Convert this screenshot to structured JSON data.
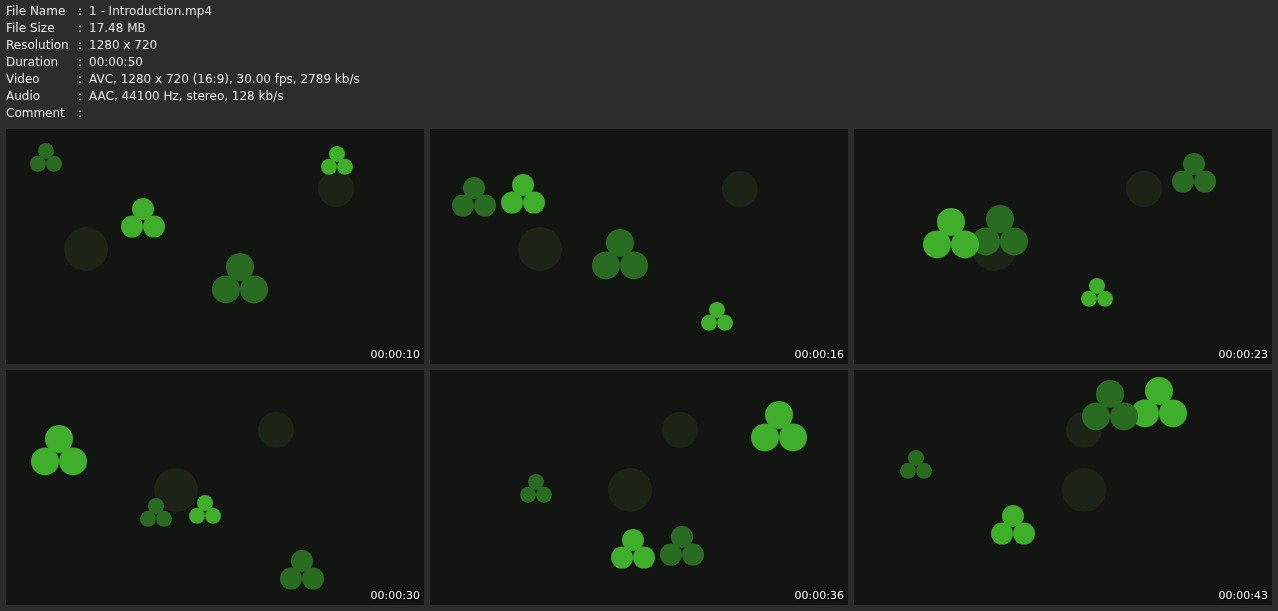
{
  "info": [
    {
      "label": "File Name",
      "sep": ":",
      "value": "1 - Introduction.mp4"
    },
    {
      "label": "File Size",
      "sep": ":",
      "value": "17.48 MB"
    },
    {
      "label": "Resolution",
      "sep": ":",
      "value": "1280 x 720"
    },
    {
      "label": "Duration",
      "sep": ":",
      "value": "00:00:50"
    },
    {
      "label": "Video",
      "sep": ":",
      "value": "AVC, 1280 x 720 (16:9), 30.00 fps, 2789 kb/s"
    },
    {
      "label": "Audio",
      "sep": ":",
      "value": "AAC, 44100 Hz, stereo, 128 kb/s"
    },
    {
      "label": "Comment",
      "sep": ":"
    }
  ],
  "thumbnails": [
    {
      "kind": "picture",
      "time": "00:00:10"
    },
    {
      "kind": "picture",
      "time": "00:00:16"
    },
    {
      "kind": "picture",
      "time": "00:00:23"
    },
    {
      "kind": "picture",
      "time": "00:00:30"
    },
    {
      "kind": "picture",
      "time": "00:00:36"
    },
    {
      "kind": "picture",
      "time": "00:00:43"
    }
  ]
}
